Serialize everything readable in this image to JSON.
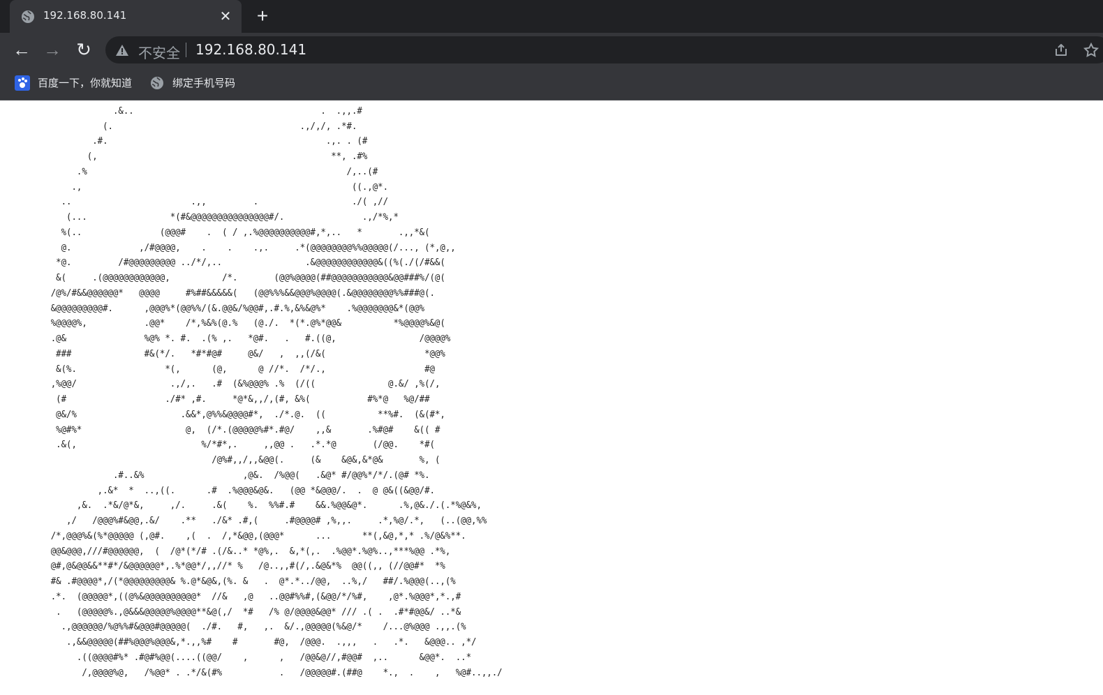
{
  "tab": {
    "title": "192.168.80.141"
  },
  "toolbar": {
    "security_label": "不安全",
    "url": "192.168.80.141",
    "icons": {
      "back": "arrow-left-icon",
      "forward": "arrow-right-icon",
      "reload": "reload-icon",
      "warning": "warning-icon",
      "share": "share-icon",
      "bookmark": "star-icon"
    }
  },
  "bookmarks": [
    {
      "label": "百度一下，你就知道",
      "icon": "baidu-paw-icon"
    },
    {
      "label": "绑定手机号码",
      "icon": "globe-icon"
    }
  ],
  "page": {
    "ascii_art": "                  %.                                     .   ....,,.#\n                .&..                                    .  .,,.#\n              (.                                    .,/,/, .*#.\n            .#.                                          .,. . (#\n           (,                                             **, .#%\n         .%                                                  /,..(#\n        .,                                                    ((.,@*.\n      ..                       .,,         .                  ./( ,//\n       (...                *(#&@@@@@@@@@@@@@@@#/.               .,/*%,*\n      %(..               (@@@#    .  ( / ,.%@@@@@@@@@@#,*,..   *       .,,*&(\n      @.             ,/#@@@@,    .    .    .,.     .*(@@@@@@@@%%@@@@@(/..., (*,@,,\n     *@.         /#@@@@@@@@@ ../*/,..                .&@@@@@@@@@@@@&((%(./(/#&&(\n     &(     .(@@@@@@@@@@@@,          /*.       (@@%@@@@(##@@@@@@@@@@@&@@###%/(@(\n    /@%/#&&@@@@@@*   @@@@     #%##&&&&&(   (@@%%%&&@@@%@@@@(.&@@@@@@@@%%###@(.\n    &@@@@@@@@@#.      ,@@@%*(@@%%/(&.@@&/%@@#,.#.%,&%&@%*    .%@@@@@@@&*(@@%\n    %@@@@%,           .@@*    /*,%&%(@.%   (@./.  *(*.@%*@@&          *%@@@@%&@(\n    .@&               %@% *. #.  .(% ,.   *@#.   .   #.((@,                /@@@@%\n     ###              #&(*/.   *#*#@#     @&/   ,  ,,(/&(                   *@@%\n     &(%.                 *(,      (@,      @ //*.  /*/.,                   #@\n    ,%@@/                  .,/,.   .#  (&%@@@% .%  (/((              @.&/ ,%(/,\n     (#                   ./#* ,#.     *@*&,,/,(#, &%(           #%*@   %@/##\n     @&/%                    .&&*,@%%&@@@@#*,  ./*.@.  ((          **%#.  (&(#*,\n     %@#%*                    @,  (/*.(@@@@@%#*.#@/    ,,&       .%#@#    &(( #\n     .&(,                        %/*#*,.     ,,@@ .   .*.*@       (/@@.    *#(\n                                   /@%#,,/,,&@@(.     (&    &@&,&*@&       %, (\n                .#..&%                   ,@&.  /%@@(   .&@* #/@@%*/*/.(@# *%.\n             ,.&*  *  ..,((.      .#  .%@@@&@&.   (@@ *&@@@/.  .  @ @&((&@@/#.\n         ,&.  .*&/@*&,     ,/.     .&(    %.  %%#.#    &&.%@@&@*.      .%,@&./.(.*%@&%,\n       ,/   /@@@%#&@@,.&/    .**   ./&* .#,(     .#@@@@# ,%,,.     .*,%@/.*,   (..(@@,%%\n    /*,@@@%&(%*@@@@@ (,@#.    ,(  .  /,*&@@,(@@@*      ...      **(,&@,*,* .%/@&%**.\n    @@&@@@,///#@@@@@@,  (  /@*(*/# .(/&..* *@%,.  &,*(,.  .%@@*.%@%..,***%@@ .*%,\n    @#,@&@@&&**#*/&@@@@@@*,.%*@@*/,,//* %   /@..,,#(/,.&@&*%  @@((,, (//@@#*  *%\n    #& .#@@@@*,/(*@@@@@@@@@& %.@*&@&,(%. &   .  @*.*../@@,  ..%,/   ##/.%@@@(..,(%\n    .*.  (@@@@@*,((@%&@@@@@@@@@@*  //&   ,@   ..@@#%%#,(&@@/*/%#,    ,@*.%@@@*,*.,#\n     .   (@@@@@%.,@&&&@@@@@%@@@@**&@(,/  *#   /% @/@@@@&@@* /// .( .  .#*#@@&/ ..*&\n      .,@@@@@@/%@%%#&@@@#@@@@@(  ./#.   #,   ,.  &/.,@@@@@(%&@/*    /...@%@@@ .,,.(%\n       .,&&@@@@@(##%@@@%@@@&,*.,,%#    #       #@,  /@@@.  .,,,   .   .*.   &@@@.. ,*/\n         .((@@@@#%* .#@#%@@(....((@@/    ,      ,   /@@&@//,#@@#  ,..      &@@*.  ..*\n          /,@@@@%@,   /%@@* . .*/&(#%           .   /@@@@@#.(##@    *.,  .    ,   %@#..,,./"
  }
}
